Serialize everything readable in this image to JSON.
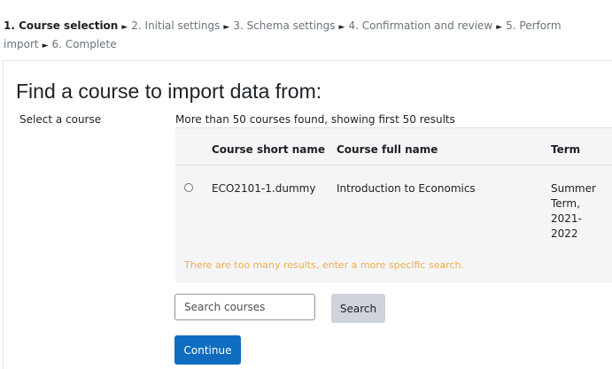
{
  "progress": {
    "steps": [
      {
        "label": "1. Course selection",
        "current": true
      },
      {
        "label": "2. Initial settings",
        "current": false
      },
      {
        "label": "3. Schema settings",
        "current": false
      },
      {
        "label": "4. Confirmation and review",
        "current": false
      },
      {
        "label": "5. Perform import",
        "current": false
      },
      {
        "label": "6. Complete",
        "current": false
      }
    ],
    "separator": "►"
  },
  "page": {
    "heading": "Find a course to import data from:",
    "field_label": "Select a course",
    "results_note": "More than 50 courses found, showing first 50 results"
  },
  "table": {
    "columns": [
      "Course short name",
      "Course full name",
      "Term"
    ],
    "rows": [
      {
        "selected": false,
        "short_name": "ECO2101-1.dummy",
        "full_name": "Introduction to Economics",
        "term": "Summer Term, 2021-2022"
      }
    ]
  },
  "warning": {
    "text": "There are too many results, enter a more specific search.",
    "color": "#f0ad4e"
  },
  "search": {
    "placeholder": "Search courses",
    "value": "",
    "button_label": "Search"
  },
  "actions": {
    "continue_label": "Continue",
    "primary_color": "#0f6cbf"
  }
}
